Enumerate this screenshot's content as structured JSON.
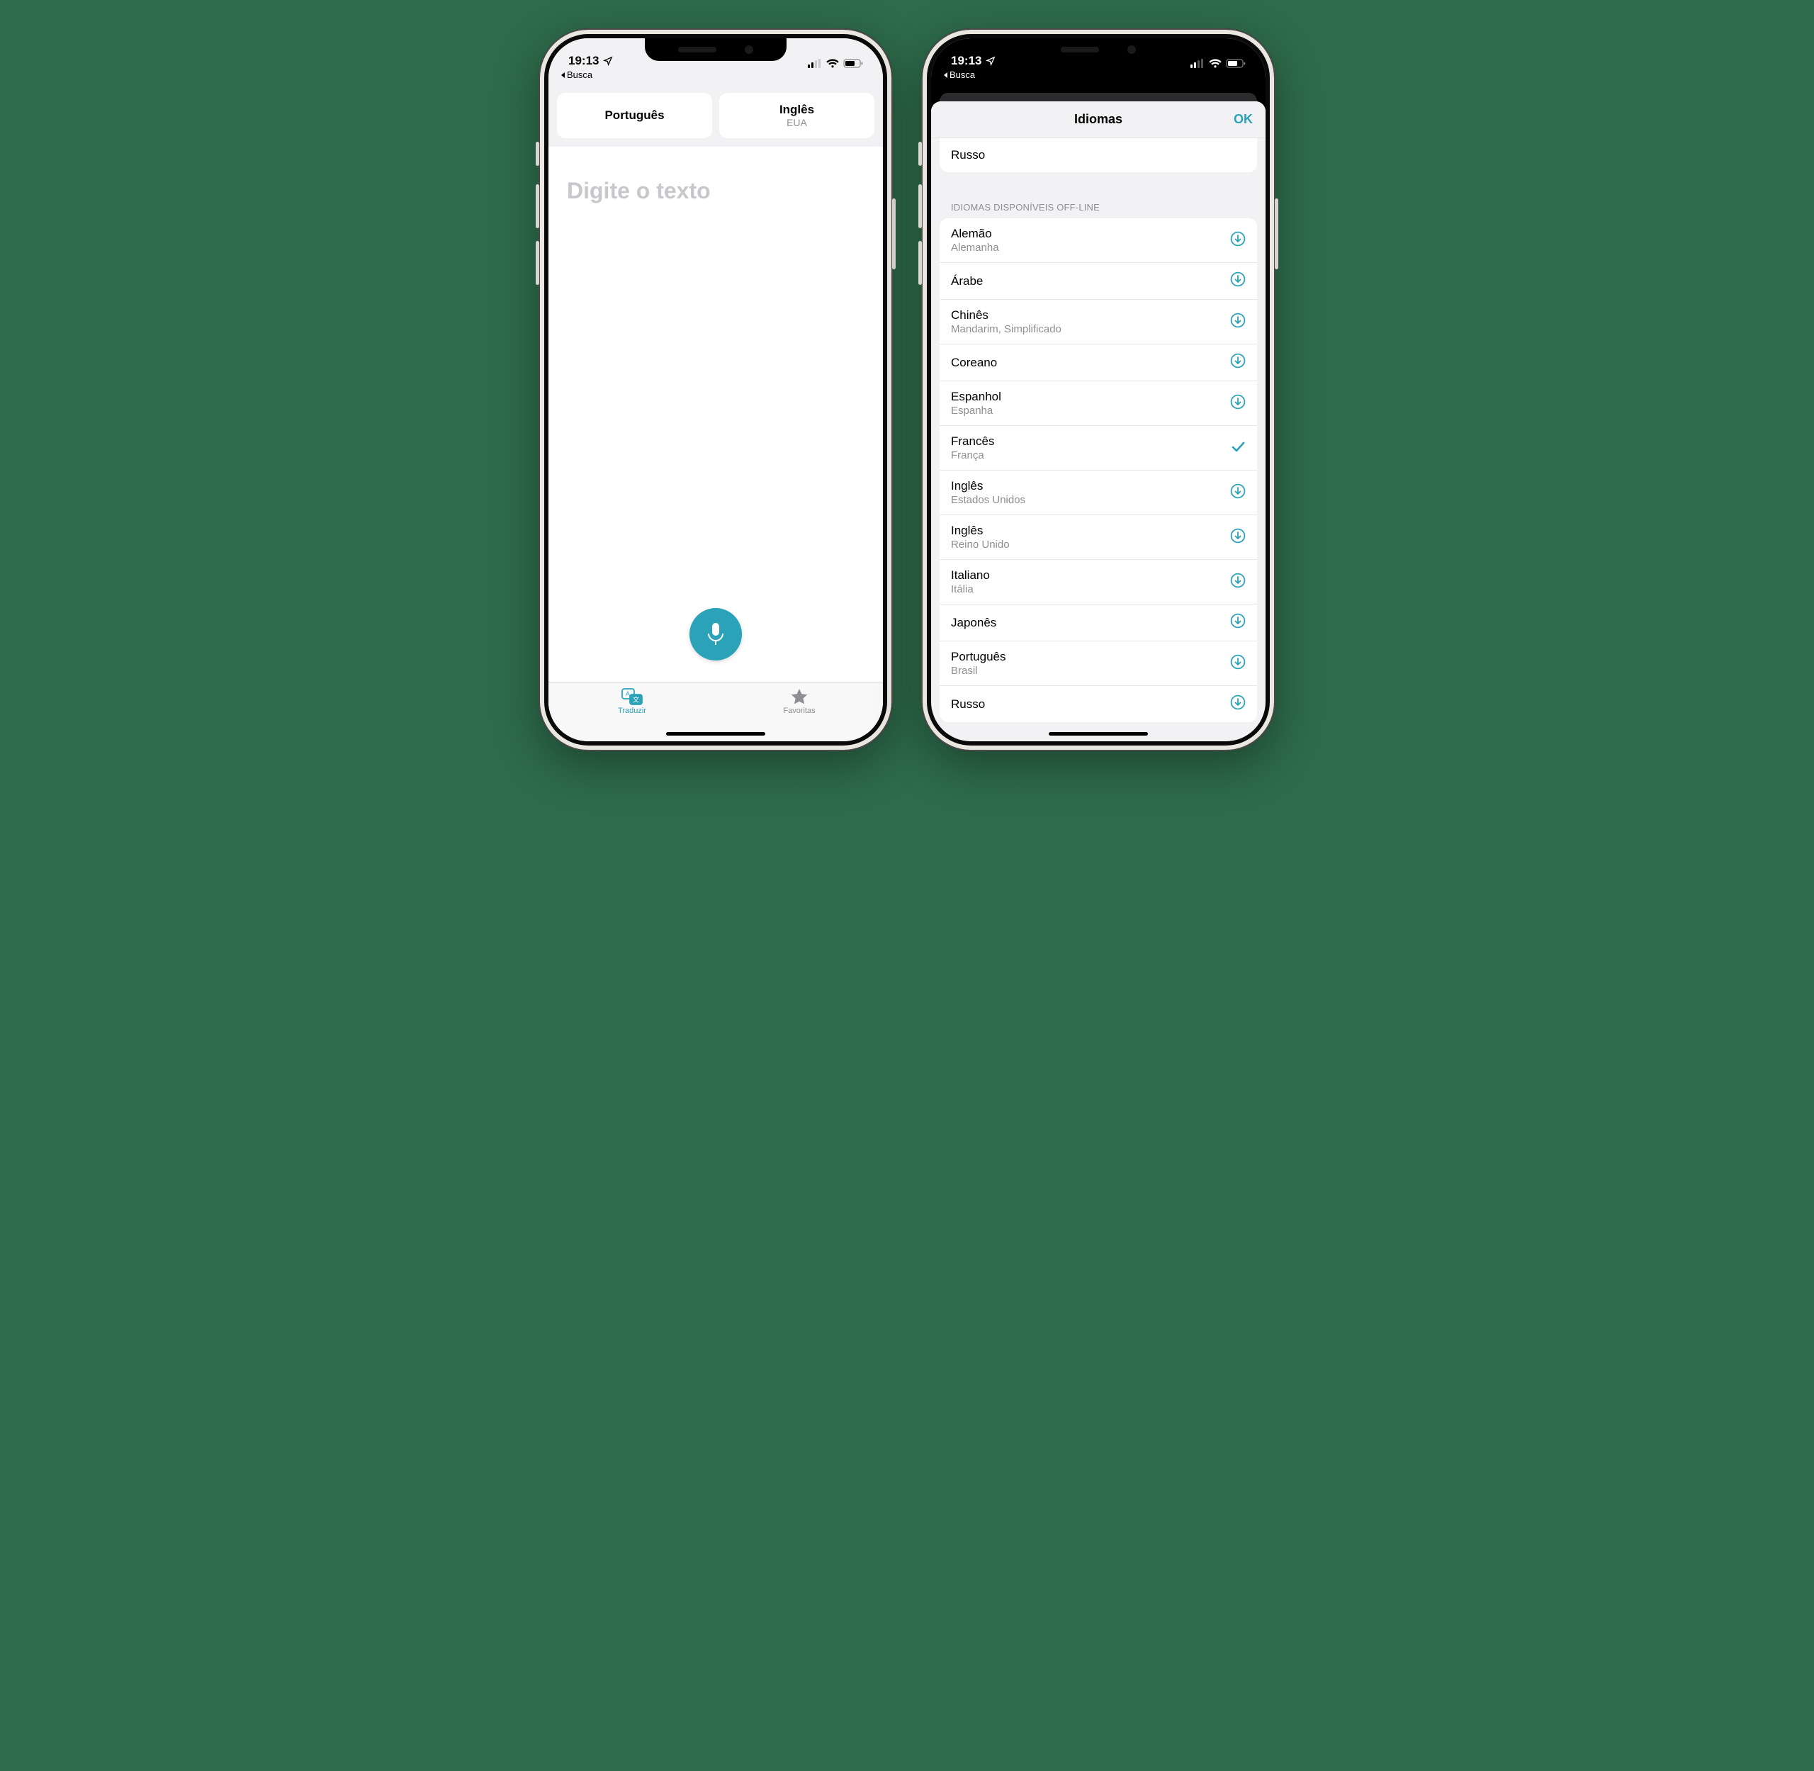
{
  "status": {
    "time": "19:13",
    "back_app": "Busca"
  },
  "left": {
    "lang_from": "Português",
    "lang_to": "Inglês",
    "lang_to_sub": "EUA",
    "placeholder": "Digite o texto",
    "tabs": {
      "translate": "Traduzir",
      "favorites": "Favoritas"
    }
  },
  "right": {
    "title": "Idiomas",
    "ok": "OK",
    "top_row": "Russo",
    "section_header": "IDIOMAS DISPONÍVEIS OFF-LINE",
    "languages": [
      {
        "name": "Alemão",
        "sub": "Alemanha",
        "state": "download"
      },
      {
        "name": "Árabe",
        "sub": "",
        "state": "download"
      },
      {
        "name": "Chinês",
        "sub": "Mandarim, Simplificado",
        "state": "download"
      },
      {
        "name": "Coreano",
        "sub": "",
        "state": "download"
      },
      {
        "name": "Espanhol",
        "sub": "Espanha",
        "state": "download"
      },
      {
        "name": "Francês",
        "sub": "França",
        "state": "selected"
      },
      {
        "name": "Inglês",
        "sub": "Estados Unidos",
        "state": "download"
      },
      {
        "name": "Inglês",
        "sub": "Reino Unido",
        "state": "download"
      },
      {
        "name": "Italiano",
        "sub": "Itália",
        "state": "download"
      },
      {
        "name": "Japonês",
        "sub": "",
        "state": "download"
      },
      {
        "name": "Português",
        "sub": "Brasil",
        "state": "download"
      },
      {
        "name": "Russo",
        "sub": "",
        "state": "download"
      }
    ]
  },
  "colors": {
    "accent": "#2aa3b8"
  }
}
